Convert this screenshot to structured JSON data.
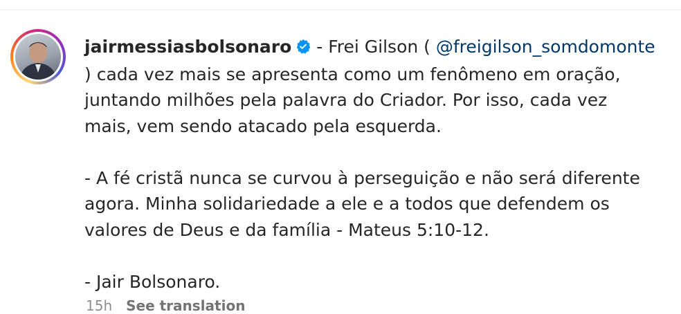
{
  "post": {
    "username": "jairmessiasbolsonaro",
    "verified_icon": "verified-badge-icon",
    "caption_intro": " - Frei Gilson ( ",
    "mention": "@freigilson_somdomonte",
    "caption_body": "\n) cada vez mais se apresenta como um fenômeno em oração,\njuntando milhões pela palavra do Criador. Por isso, cada vez\nmais, vem sendo atacado pela esquerda.\n\n- A fé cristã nunca se curvou à perseguição e não será diferente\nagora. Minha solidariedade a ele e a todos que defendem os\nvalores de Deus e da família - Mateus 5:10-12.\n\n- Jair Bolsonaro.",
    "time_ago": "15h",
    "see_translation": "See translation"
  },
  "colors": {
    "verified_blue": "#0095f6",
    "mention_link": "#00376b",
    "muted_text": "#8e8e8e"
  }
}
